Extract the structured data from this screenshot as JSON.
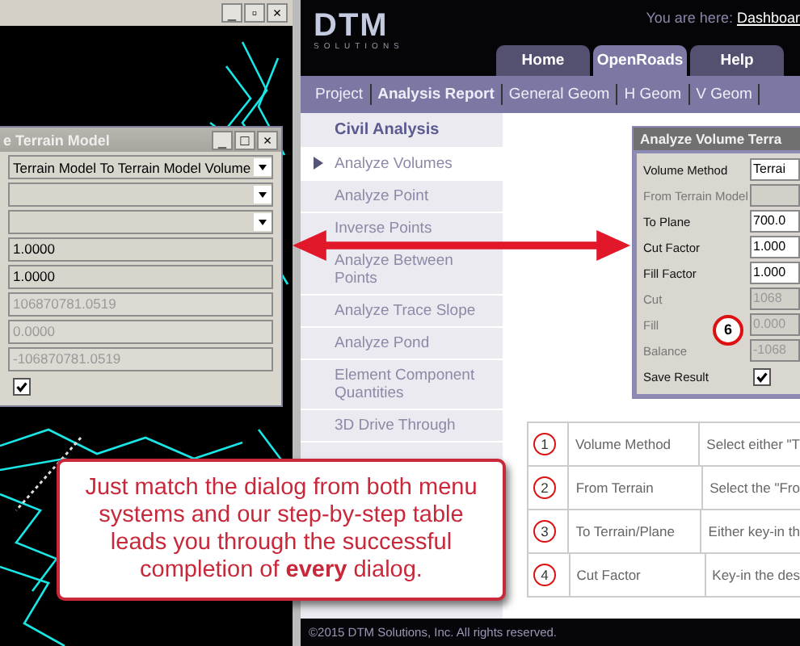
{
  "cad_window": {
    "buttons": [
      "_",
      "▫",
      "×"
    ]
  },
  "terrain_dialog": {
    "title": "e Terrain Model",
    "buttons": [
      "_",
      "□",
      "×"
    ],
    "rows": [
      {
        "kind": "dropdown",
        "value": "Terrain Model To Terrain Model Volume"
      },
      {
        "kind": "dropdown",
        "value": ""
      },
      {
        "kind": "dropdown",
        "value": ""
      },
      {
        "kind": "field",
        "value": "1.0000",
        "disabled": false
      },
      {
        "kind": "field",
        "value": "1.0000",
        "disabled": false
      },
      {
        "kind": "field",
        "value": "106870781.0519",
        "disabled": true
      },
      {
        "kind": "field",
        "value": "0.0000",
        "disabled": true
      },
      {
        "kind": "field",
        "value": "-106870781.0519",
        "disabled": true
      },
      {
        "kind": "checkbox",
        "checked": true
      }
    ]
  },
  "site": {
    "logo": "DTM",
    "logo_sub": "SOLUTIONS",
    "breadcrumb_label": "You are here:",
    "breadcrumb_link": "Dashboar",
    "tabs": [
      {
        "label": "Home",
        "selected": false
      },
      {
        "label": "OpenRoads",
        "selected": true
      },
      {
        "label": "Help",
        "selected": false
      }
    ],
    "nav": [
      {
        "label": "Project",
        "selected": false
      },
      {
        "label": "Analysis Report",
        "selected": true
      },
      {
        "label": "General Geom",
        "selected": false
      },
      {
        "label": "H Geom",
        "selected": false
      },
      {
        "label": "V Geom",
        "selected": false
      }
    ],
    "sidebar": {
      "heading": "Civil Analysis",
      "items": [
        {
          "label": "Analyze Volumes",
          "selected": true
        },
        {
          "label": "Analyze Point",
          "selected": false
        },
        {
          "label": "Inverse Points",
          "selected": false
        },
        {
          "label": "Analyze Between Points",
          "selected": false
        },
        {
          "label": "Analyze Trace Slope",
          "selected": false
        },
        {
          "label": "Analyze Pond",
          "selected": false
        },
        {
          "label": "Element Component Quantities",
          "selected": false
        },
        {
          "label": "3D Drive Through",
          "selected": false
        }
      ]
    },
    "volume_dialog": {
      "title": "Analyze Volume Terra",
      "badge": "6",
      "rows": [
        {
          "label": "Volume Method",
          "kind": "field",
          "value": "Terrai",
          "disabled": false
        },
        {
          "label": "From Terrain Model",
          "kind": "field",
          "value": "",
          "disabled": true
        },
        {
          "label": "To Plane",
          "kind": "field",
          "value": "700.0",
          "disabled": false
        },
        {
          "label": "Cut Factor",
          "kind": "field",
          "value": "1.000",
          "disabled": false
        },
        {
          "label": "Fill Factor",
          "kind": "field",
          "value": "1.000",
          "disabled": false
        },
        {
          "label": "Cut",
          "kind": "field",
          "value": "1068",
          "disabled": true
        },
        {
          "label": "Fill",
          "kind": "field",
          "value": "0.000",
          "disabled": true
        },
        {
          "label": "Balance",
          "kind": "field",
          "value": "-1068",
          "disabled": true
        },
        {
          "label": "Save Result",
          "kind": "checkbox",
          "checked": true
        }
      ]
    },
    "steps_table": {
      "rows": [
        {
          "number": "1",
          "label": "Volume Method",
          "description": "Select either \"T"
        },
        {
          "number": "2",
          "label": "From Terrain",
          "description": "Select the \"Fro"
        },
        {
          "number": "3",
          "label": "To Terrain/Plane",
          "description": "Either key-in th"
        },
        {
          "number": "4",
          "label": "Cut Factor",
          "description": "Key-in the des"
        }
      ]
    },
    "footer": "©2015 DTM Solutions, Inc. All rights reserved."
  },
  "callout": "Just match the dialog from both menu systems and our step-by-step table leads you through the successful completion of **every** dialog."
}
